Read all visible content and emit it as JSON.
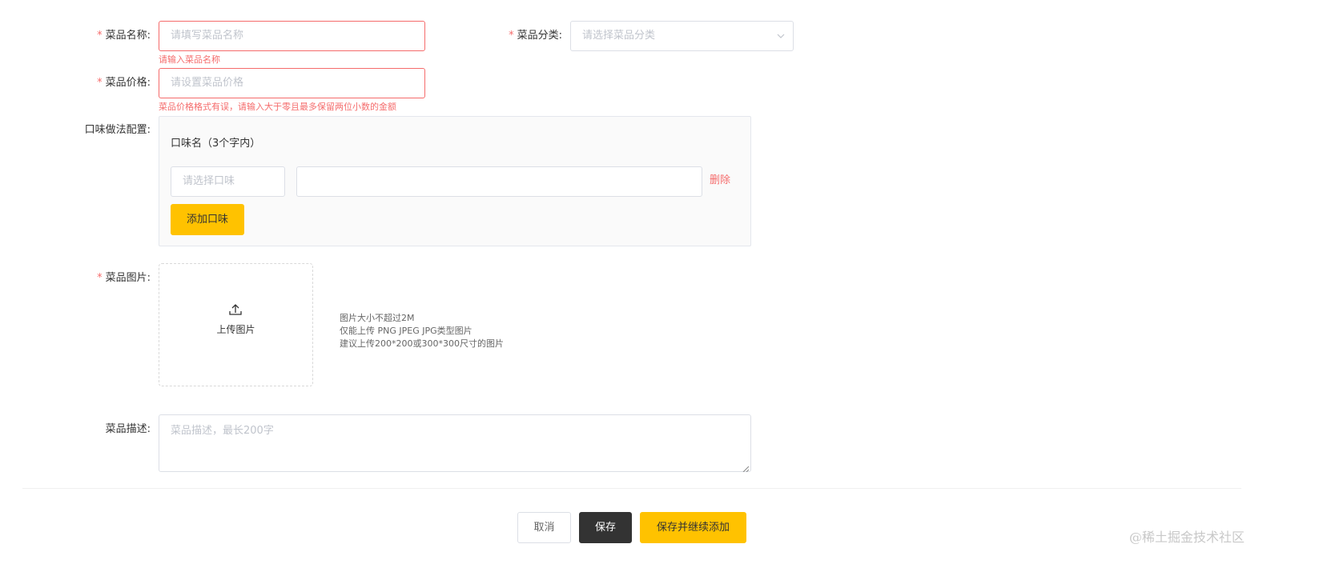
{
  "form": {
    "dish_name": {
      "label": "菜品名称:",
      "required_mark": "*",
      "placeholder": "请填写菜品名称",
      "error": "请输入菜品名称"
    },
    "dish_category": {
      "label": "菜品分类:",
      "required_mark": "*",
      "placeholder": "请选择菜品分类"
    },
    "dish_price": {
      "label": "菜品价格:",
      "required_mark": "*",
      "placeholder": "请设置菜品价格",
      "error": "菜品价格格式有误，请输入大于零且最多保留两位小数的金额"
    },
    "flavor_config": {
      "label": "口味做法配置:",
      "flavor_name_header": "口味名（3个字内）",
      "flavor_select_placeholder": "请选择口味",
      "flavor_values_value": "",
      "delete_label": "删除",
      "add_flavor_label": "添加口味"
    },
    "dish_image": {
      "label": "菜品图片:",
      "required_mark": "*",
      "upload_label": "上传图片",
      "upload_icon": "upload-icon",
      "hints": [
        "图片大小不超过2M",
        "仅能上传 PNG JPEG JPG类型图片",
        "建议上传200*200或300*300尺寸的图片"
      ]
    },
    "dish_description": {
      "label": "菜品描述:",
      "placeholder": "菜品描述，最长200字"
    }
  },
  "actions": {
    "cancel_label": "取消",
    "save_label": "保存",
    "save_continue_label": "保存并继续添加"
  },
  "watermark": "@稀土掘金技术社区",
  "colors": {
    "accent": "#ffc200",
    "error": "#f56c6c",
    "dark_button": "#333333"
  }
}
